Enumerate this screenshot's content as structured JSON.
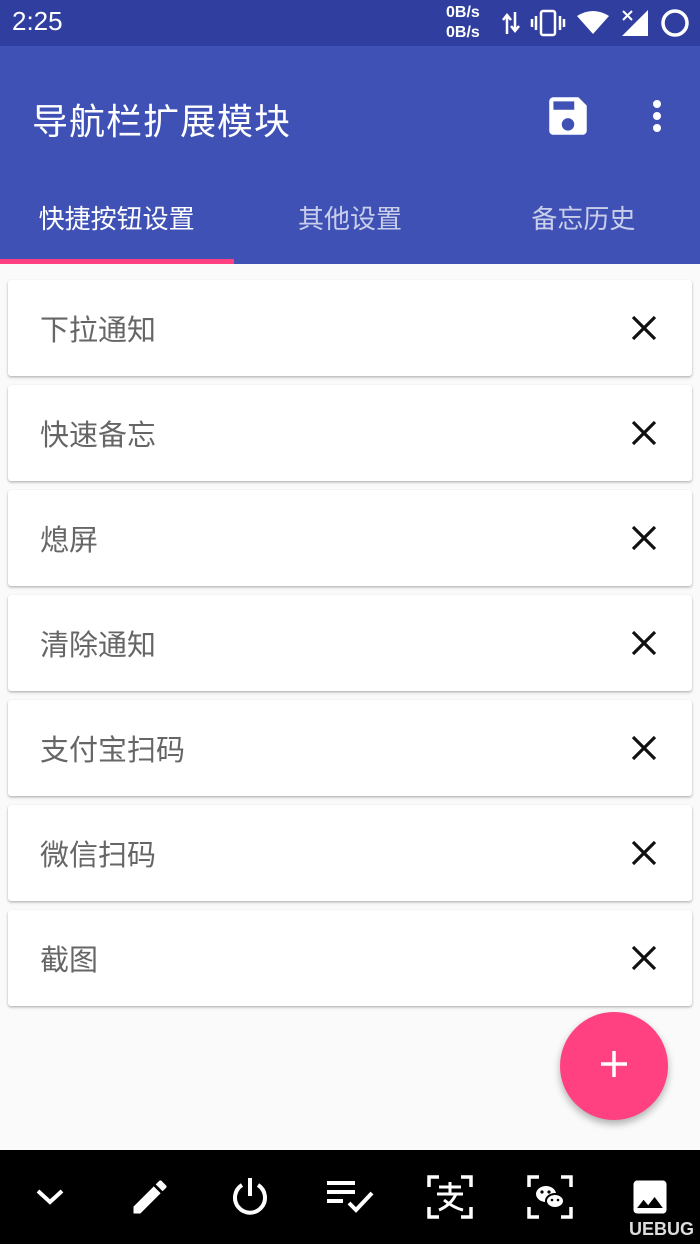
{
  "status_bar": {
    "time": "2:25",
    "net_up": "0B/s",
    "net_down": "0B/s",
    "icons": [
      "data-transfer-icon",
      "vibrate-icon",
      "wifi-icon",
      "signal-off-icon",
      "circle-icon"
    ]
  },
  "app_bar": {
    "title": "导航栏扩展模块",
    "actions": [
      "save-icon",
      "more-vert-icon"
    ]
  },
  "tabs": [
    {
      "label": "快捷按钮设置",
      "active": true
    },
    {
      "label": "其他设置",
      "active": false
    },
    {
      "label": "备忘历史",
      "active": false
    }
  ],
  "items": [
    {
      "label": "下拉通知"
    },
    {
      "label": "快速备忘"
    },
    {
      "label": "熄屏"
    },
    {
      "label": "清除通知"
    },
    {
      "label": "支付宝扫码"
    },
    {
      "label": "微信扫码"
    },
    {
      "label": "截图"
    }
  ],
  "fab": {
    "icon": "add-icon"
  },
  "bottom_bar": {
    "buttons": [
      "chevron-down-icon",
      "pencil-icon",
      "power-icon",
      "checklist-icon",
      "alipay-scan-icon",
      "wechat-scan-icon",
      "image-icon"
    ]
  },
  "watermark": "UEBUG",
  "colors": {
    "primary": "#3f51b5",
    "primary_dark": "#303f9f",
    "accent": "#ff4081",
    "background": "#fafafa"
  }
}
